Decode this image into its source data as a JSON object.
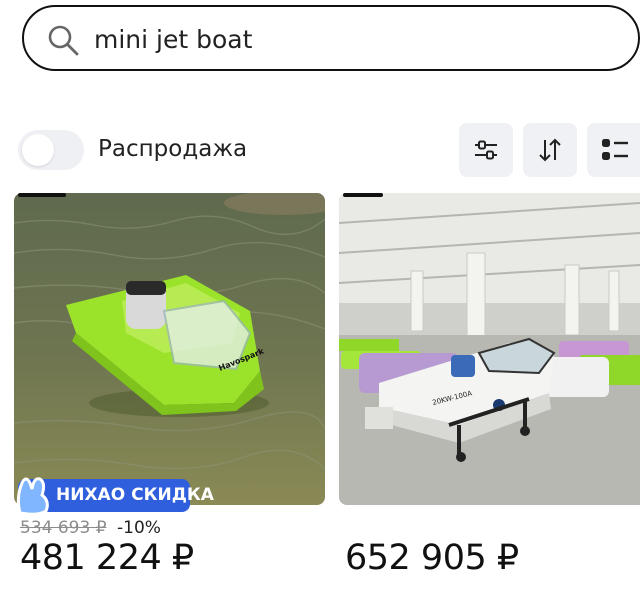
{
  "search": {
    "value": "mini jet boat"
  },
  "filters": {
    "sale_label": "Распродажа",
    "sale_enabled": false
  },
  "toolbar": {
    "filter_icon": "sliders-icon",
    "sort_icon": "sort-arrows-icon",
    "view_icon": "list-view-icon"
  },
  "products": [
    {
      "image": "lime green mini jet boat on water",
      "badge": "НИХАО СКИДКА",
      "old_price": "534 693 ₽",
      "discount": "-10%",
      "price": "481 224 ₽"
    },
    {
      "image": "mini jet boats in warehouse",
      "price": "652 905 ₽"
    }
  ],
  "colors": {
    "badge_blue": "#2f5fdd",
    "button_bg": "#eff1f4",
    "boat_green": "#9be22a"
  }
}
